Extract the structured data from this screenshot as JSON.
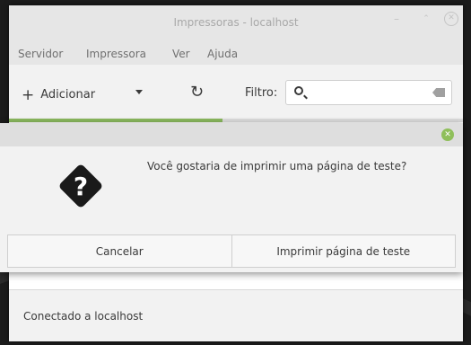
{
  "window": {
    "title": "Impressoras - localhost",
    "controls": [
      "minimize-icon",
      "maximize-icon",
      "close-icon"
    ]
  },
  "menubar": {
    "items": [
      "Servidor",
      "Impressora",
      "Ver",
      "Ajuda"
    ]
  },
  "toolbar": {
    "add_label": "Adicionar",
    "add_icon": "plus-icon",
    "dropdown_icon": "caret-down-icon",
    "refresh_icon": "refresh-icon",
    "filter_label": "Filtro:",
    "search_value": "",
    "search_icon": "magnifier-icon",
    "clear_icon": "clear-text-icon"
  },
  "progress": {
    "fraction": 0.47,
    "color": "#8ab85e"
  },
  "dialog": {
    "close_icon": "close-icon",
    "question_icon": "question-icon",
    "message": "Você gostaria de imprimir uma página de teste?",
    "buttons": {
      "cancel": "Cancelar",
      "print": "Imprimir página de teste"
    }
  },
  "statusbar": {
    "text": "Conectado a localhost"
  }
}
